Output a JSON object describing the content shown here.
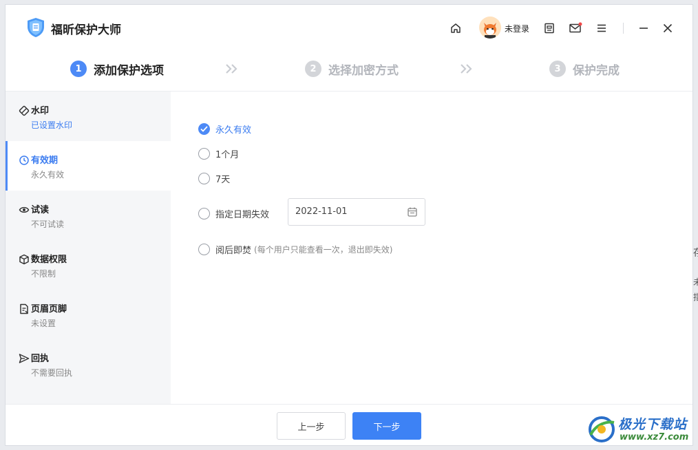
{
  "app": {
    "name": "福昕保护大师"
  },
  "titlebar": {
    "login_text": "未登录"
  },
  "steps": [
    {
      "num": "1",
      "label": "添加保护选项",
      "state": "active"
    },
    {
      "num": "2",
      "label": "选择加密方式",
      "state": "inactive"
    },
    {
      "num": "3",
      "label": "保护完成",
      "state": "inactive"
    }
  ],
  "sidebar": {
    "items": [
      {
        "title": "水印",
        "sub": "已设置水印",
        "icon": "watermark-icon"
      },
      {
        "title": "有效期",
        "sub": "永久有效",
        "icon": "clock-icon"
      },
      {
        "title": "试读",
        "sub": "不可试读",
        "icon": "eye-icon"
      },
      {
        "title": "数据权限",
        "sub": "不限制",
        "icon": "cube-icon"
      },
      {
        "title": "页眉页脚",
        "sub": "未设置",
        "icon": "page-edit-icon"
      },
      {
        "title": "回执",
        "sub": "不需要回执",
        "icon": "send-icon"
      }
    ],
    "active_index": 1
  },
  "validity": {
    "options": [
      {
        "label": "永久有效",
        "checked": true
      },
      {
        "label": "1个月",
        "checked": false
      },
      {
        "label": "7天",
        "checked": false
      },
      {
        "label": "指定日期失效",
        "checked": false
      },
      {
        "label": "阅后即焚",
        "hint": "(每个用户只能查看一次，退出即失效)",
        "checked": false
      }
    ],
    "date_value": "2022-11-01"
  },
  "footer": {
    "prev_label": "上一步",
    "next_label": "下一步"
  },
  "edge_text": [
    "存",
    "未",
    "指"
  ],
  "watermark": {
    "title": "极光下载站",
    "url": "www.xz7.com"
  },
  "colors": {
    "accent": "#4d8af6",
    "primary_button": "#3d82f5",
    "sidebar_bg": "#f5f6f8"
  }
}
